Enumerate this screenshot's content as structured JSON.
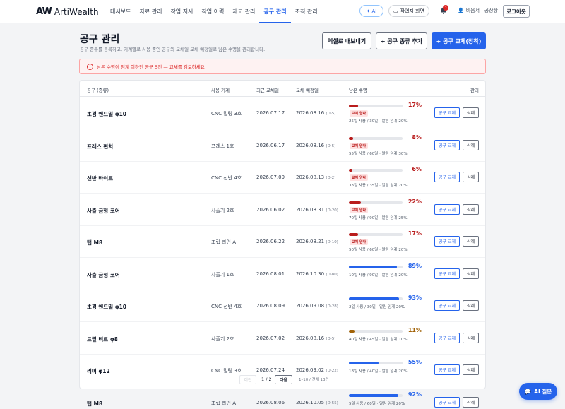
{
  "app": {
    "logo_mark": "AW",
    "name": "ArtiWealth"
  },
  "nav": [
    {
      "label": "대시보드"
    },
    {
      "label": "자료 관리"
    },
    {
      "label": "작업 지시"
    },
    {
      "label": "작업 이력"
    },
    {
      "label": "재고 관리"
    },
    {
      "label": "공구 관리",
      "active": true
    },
    {
      "label": "조직 관리"
    }
  ],
  "header": {
    "ai_label": "AI",
    "worker_label": "작업자 화면",
    "notif_count": "3",
    "user_label": "비음서 · 공장장",
    "logout_label": "로그아웃"
  },
  "page": {
    "title": "공구 관리",
    "description": "공구 종류를 등록하고, 기계별로 사용 중인 공구의 교체일·교체 예정일로 남은 수명을 관리합니다.",
    "export_label": "엑셀로 내보내기",
    "add_type_label": "+ 공구 종류 추가",
    "replace_label": "+ 공구 교체(장착)"
  },
  "alert": {
    "icon": "!",
    "text": "남은 수명이 임계 이하인 공구 5건 — 교체를 검토하세요"
  },
  "table": {
    "headers": {
      "tool": "공구 (종류)",
      "machine": "사용 기계",
      "last": "최근 교체일",
      "next": "교체 예정일",
      "life": "남은 수명",
      "manage": "관리"
    },
    "replace_btn": "공구 교체",
    "delete_btn": "삭제",
    "badge_text": "교체 임박",
    "rows": [
      {
        "tool": "초경 엔드밀 φ10",
        "machine": "CNC 밀링 3호",
        "last": "2026.07.17",
        "next": "2026.08.16",
        "dday": "(D-5)",
        "pct": 17,
        "pct_label": "17%",
        "warn": true,
        "usage": "25일 사용 / 30일 · 알림 임계 20%",
        "color": "#b91c1c"
      },
      {
        "tool": "프레스 펀치",
        "machine": "프레스 1호",
        "last": "2026.06.17",
        "next": "2026.08.16",
        "dday": "(D-5)",
        "pct": 8,
        "pct_label": "8%",
        "warn": true,
        "usage": "55일 사용 / 60일 · 알림 임계 30%",
        "color": "#b91c1c"
      },
      {
        "tool": "선반 바이트",
        "machine": "CNC 선반 4호",
        "last": "2026.07.09",
        "next": "2026.08.13",
        "dday": "(D-2)",
        "pct": 6,
        "pct_label": "6%",
        "warn": true,
        "usage": "33일 사용 / 35일 · 알림 임계 20%",
        "color": "#b91c1c"
      },
      {
        "tool": "사출 금형 코어",
        "machine": "사출기 2호",
        "last": "2026.06.02",
        "next": "2026.08.31",
        "dday": "(D-20)",
        "pct": 22,
        "pct_label": "22%",
        "warn": true,
        "usage": "70일 사용 / 90일 · 알림 임계 25%",
        "color": "#b91c1c"
      },
      {
        "tool": "탭 M8",
        "machine": "조립 라인 A",
        "last": "2026.06.22",
        "next": "2026.08.21",
        "dday": "(D-10)",
        "pct": 17,
        "pct_label": "17%",
        "warn": true,
        "usage": "50일 사용 / 60일 · 알림 임계 20%",
        "color": "#b91c1c"
      },
      {
        "tool": "사출 금형 코어",
        "machine": "사출기 1호",
        "last": "2026.08.01",
        "next": "2026.10.30",
        "dday": "(D-80)",
        "pct": 89,
        "pct_label": "89%",
        "warn": false,
        "usage": "10일 사용 / 90일 · 알림 임계 20%",
        "color": "#2563eb"
      },
      {
        "tool": "초경 엔드밀 φ10",
        "machine": "CNC 선반 4호",
        "last": "2026.08.09",
        "next": "2026.09.08",
        "dday": "(D-28)",
        "pct": 93,
        "pct_label": "93%",
        "warn": false,
        "usage": "2일 사용 / 30일 · 알림 임계 20%",
        "color": "#2563eb"
      },
      {
        "tool": "드릴 비트 φ8",
        "machine": "사출기 2호",
        "last": "2026.07.02",
        "next": "2026.08.16",
        "dday": "(D-5)",
        "pct": 11,
        "pct_label": "11%",
        "warn": false,
        "usage": "40일 사용 / 45일 · 알림 임계 10%",
        "color": "#a16207"
      },
      {
        "tool": "리머 φ12",
        "machine": "CNC 밀링 3호",
        "last": "2026.07.24",
        "next": "2026.09.02",
        "dday": "(D-22)",
        "pct": 55,
        "pct_label": "55%",
        "warn": false,
        "usage": "18일 사용 / 40일 · 알림 임계 20%",
        "color": "#2563eb"
      },
      {
        "tool": "탭 M8",
        "machine": "조립 라인 A",
        "last": "2026.08.06",
        "next": "2026.10.05",
        "dday": "(D-55)",
        "pct": 92,
        "pct_label": "92%",
        "warn": false,
        "usage": "5일 사용 / 60일 · 알림 임계 20%",
        "color": "#2563eb"
      }
    ]
  },
  "pager": {
    "prev": "이전",
    "page": "1 / 2",
    "next": "다음",
    "info": "1–10 / 전체 13건"
  },
  "ai_question": {
    "label": "AI 질문"
  }
}
